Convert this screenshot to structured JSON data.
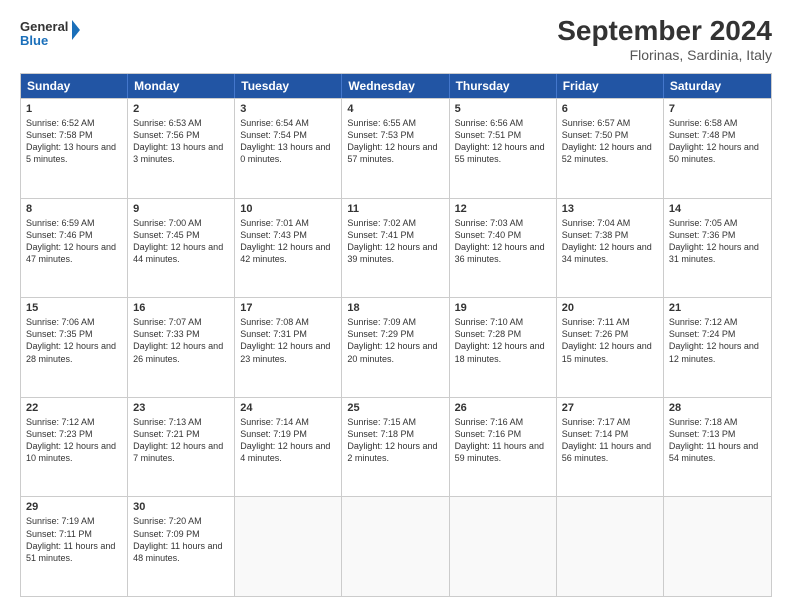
{
  "header": {
    "logo_general": "General",
    "logo_blue": "Blue",
    "month_title": "September 2024",
    "location": "Florinas, Sardinia, Italy"
  },
  "calendar": {
    "headers": [
      "Sunday",
      "Monday",
      "Tuesday",
      "Wednesday",
      "Thursday",
      "Friday",
      "Saturday"
    ],
    "weeks": [
      [
        {
          "day": "1",
          "sunrise": "6:52 AM",
          "sunset": "7:58 PM",
          "daylight": "13 hours and 5 minutes."
        },
        {
          "day": "2",
          "sunrise": "6:53 AM",
          "sunset": "7:56 PM",
          "daylight": "13 hours and 3 minutes."
        },
        {
          "day": "3",
          "sunrise": "6:54 AM",
          "sunset": "7:54 PM",
          "daylight": "13 hours and 0 minutes."
        },
        {
          "day": "4",
          "sunrise": "6:55 AM",
          "sunset": "7:53 PM",
          "daylight": "12 hours and 57 minutes."
        },
        {
          "day": "5",
          "sunrise": "6:56 AM",
          "sunset": "7:51 PM",
          "daylight": "12 hours and 55 minutes."
        },
        {
          "day": "6",
          "sunrise": "6:57 AM",
          "sunset": "7:50 PM",
          "daylight": "12 hours and 52 minutes."
        },
        {
          "day": "7",
          "sunrise": "6:58 AM",
          "sunset": "7:48 PM",
          "daylight": "12 hours and 50 minutes."
        }
      ],
      [
        {
          "day": "8",
          "sunrise": "6:59 AM",
          "sunset": "7:46 PM",
          "daylight": "12 hours and 47 minutes."
        },
        {
          "day": "9",
          "sunrise": "7:00 AM",
          "sunset": "7:45 PM",
          "daylight": "12 hours and 44 minutes."
        },
        {
          "day": "10",
          "sunrise": "7:01 AM",
          "sunset": "7:43 PM",
          "daylight": "12 hours and 42 minutes."
        },
        {
          "day": "11",
          "sunrise": "7:02 AM",
          "sunset": "7:41 PM",
          "daylight": "12 hours and 39 minutes."
        },
        {
          "day": "12",
          "sunrise": "7:03 AM",
          "sunset": "7:40 PM",
          "daylight": "12 hours and 36 minutes."
        },
        {
          "day": "13",
          "sunrise": "7:04 AM",
          "sunset": "7:38 PM",
          "daylight": "12 hours and 34 minutes."
        },
        {
          "day": "14",
          "sunrise": "7:05 AM",
          "sunset": "7:36 PM",
          "daylight": "12 hours and 31 minutes."
        }
      ],
      [
        {
          "day": "15",
          "sunrise": "7:06 AM",
          "sunset": "7:35 PM",
          "daylight": "12 hours and 28 minutes."
        },
        {
          "day": "16",
          "sunrise": "7:07 AM",
          "sunset": "7:33 PM",
          "daylight": "12 hours and 26 minutes."
        },
        {
          "day": "17",
          "sunrise": "7:08 AM",
          "sunset": "7:31 PM",
          "daylight": "12 hours and 23 minutes."
        },
        {
          "day": "18",
          "sunrise": "7:09 AM",
          "sunset": "7:29 PM",
          "daylight": "12 hours and 20 minutes."
        },
        {
          "day": "19",
          "sunrise": "7:10 AM",
          "sunset": "7:28 PM",
          "daylight": "12 hours and 18 minutes."
        },
        {
          "day": "20",
          "sunrise": "7:11 AM",
          "sunset": "7:26 PM",
          "daylight": "12 hours and 15 minutes."
        },
        {
          "day": "21",
          "sunrise": "7:12 AM",
          "sunset": "7:24 PM",
          "daylight": "12 hours and 12 minutes."
        }
      ],
      [
        {
          "day": "22",
          "sunrise": "7:12 AM",
          "sunset": "7:23 PM",
          "daylight": "12 hours and 10 minutes."
        },
        {
          "day": "23",
          "sunrise": "7:13 AM",
          "sunset": "7:21 PM",
          "daylight": "12 hours and 7 minutes."
        },
        {
          "day": "24",
          "sunrise": "7:14 AM",
          "sunset": "7:19 PM",
          "daylight": "12 hours and 4 minutes."
        },
        {
          "day": "25",
          "sunrise": "7:15 AM",
          "sunset": "7:18 PM",
          "daylight": "12 hours and 2 minutes."
        },
        {
          "day": "26",
          "sunrise": "7:16 AM",
          "sunset": "7:16 PM",
          "daylight": "11 hours and 59 minutes."
        },
        {
          "day": "27",
          "sunrise": "7:17 AM",
          "sunset": "7:14 PM",
          "daylight": "11 hours and 56 minutes."
        },
        {
          "day": "28",
          "sunrise": "7:18 AM",
          "sunset": "7:13 PM",
          "daylight": "11 hours and 54 minutes."
        }
      ],
      [
        {
          "day": "29",
          "sunrise": "7:19 AM",
          "sunset": "7:11 PM",
          "daylight": "11 hours and 51 minutes."
        },
        {
          "day": "30",
          "sunrise": "7:20 AM",
          "sunset": "7:09 PM",
          "daylight": "11 hours and 48 minutes."
        },
        null,
        null,
        null,
        null,
        null
      ]
    ]
  }
}
